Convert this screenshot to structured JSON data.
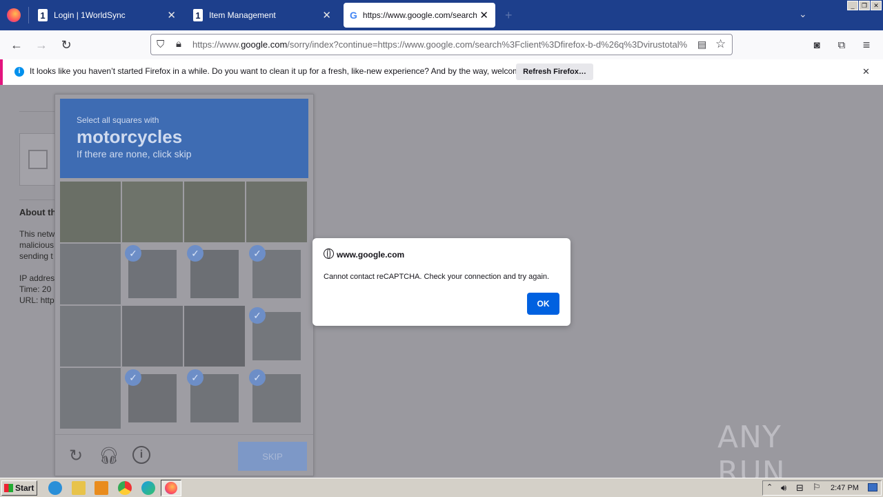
{
  "tabs": [
    {
      "label": "Login | 1WorldSync",
      "active": false
    },
    {
      "label": "Item Management",
      "active": false
    },
    {
      "label": "https://www.google.com/search?c",
      "active": true
    }
  ],
  "url": {
    "prefix": "https://www.",
    "domain": "google.com",
    "rest": "/sorry/index?continue=https://www.google.com/search%3Fclient%3Dfirefox-b-d%26q%3Dvirustotal%"
  },
  "notification": {
    "message": "It looks like you haven’t started Firefox in a while. Do you want to clean it up for a fresh, like-new experience? And by the way, welcome back!",
    "button": "Refresh Firefox…"
  },
  "page": {
    "about": "About th",
    "line1": "This netw",
    "line2": "malicious",
    "line3": "sending t",
    "ip": "IP addres",
    "time": "Time: 20",
    "urllbl": "URL: http"
  },
  "captcha": {
    "instruction": "Select all squares with",
    "target": "motorcycles",
    "hint": "If there are none, click skip",
    "skip": "SKIP",
    "selected": [
      5,
      6,
      7,
      11,
      13,
      14,
      15
    ]
  },
  "dialog": {
    "host": "www.google.com",
    "message": "Cannot contact reCAPTCHA. Check your connection and try again.",
    "ok": "OK"
  },
  "taskbar": {
    "start": "Start",
    "clock": "2:47 PM"
  },
  "watermark": "ANY RUN"
}
